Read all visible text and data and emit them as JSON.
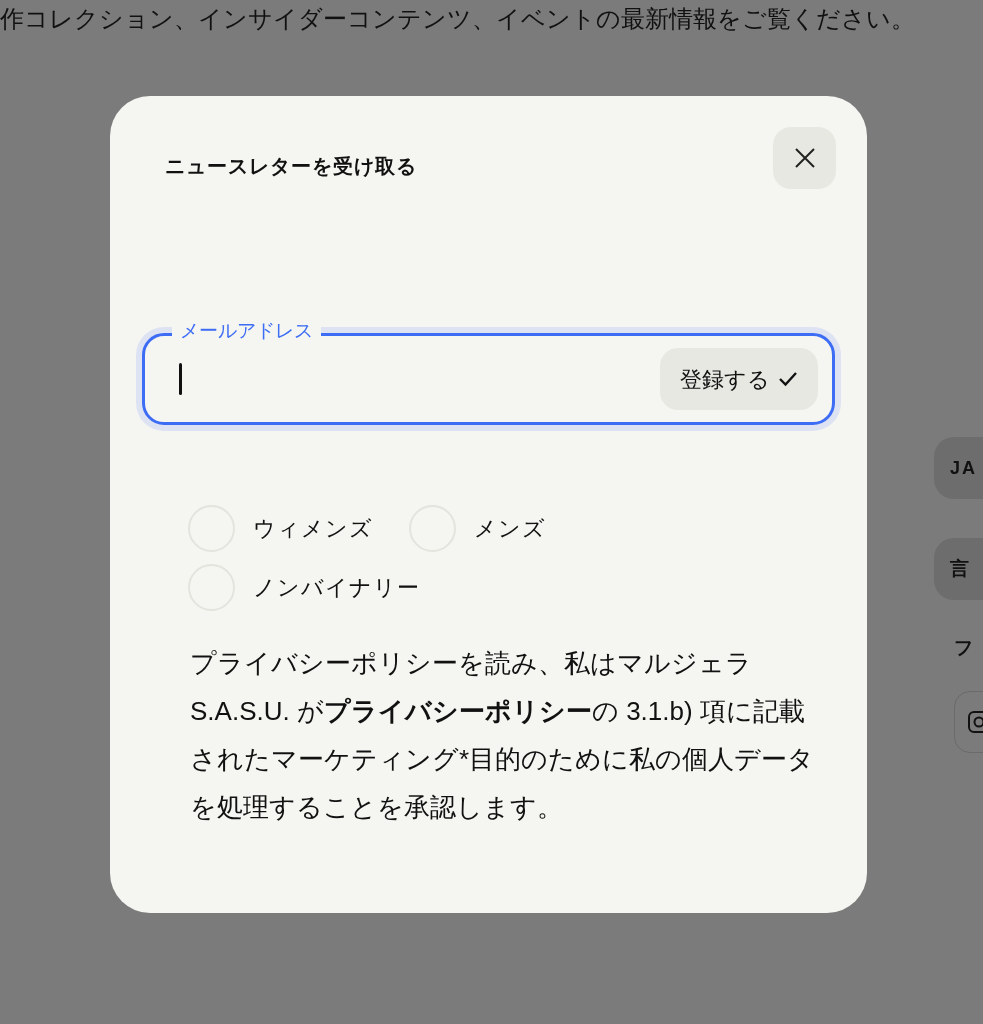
{
  "background": {
    "intro": "作コレクション、インサイダーコンテンツ、イベントの最新情報をご覧ください。",
    "language_code": "JA",
    "language_button": "言",
    "follow_heading": "フ"
  },
  "dialog": {
    "title": "ニュースレターを受け取る",
    "email_field": {
      "label": "メールアドレス",
      "focused": true
    },
    "submit": "登録する",
    "options": [
      {
        "label": "ウィメンズ",
        "selected": false
      },
      {
        "label": "メンズ",
        "selected": false
      },
      {
        "label": "ノンバイナリー",
        "selected": false
      }
    ],
    "consent": "プライバシーポリシーを読み、私はマルジェラ S.A.S.U. が**プライバシーポリシー**の 3.1.b) 項に記載されたマーケティング*目的のために私の個人データを処理することを承認します。"
  }
}
